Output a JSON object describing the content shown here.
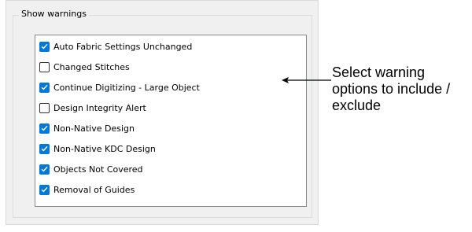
{
  "group": {
    "title": "Show warnings"
  },
  "warnings": [
    {
      "label": "Auto Fabric Settings Unchanged",
      "checked": true
    },
    {
      "label": "Changed Stitches",
      "checked": false
    },
    {
      "label": "Continue Digitizing - Large Object",
      "checked": true
    },
    {
      "label": "Design Integrity Alert",
      "checked": false
    },
    {
      "label": "Non-Native Design",
      "checked": true
    },
    {
      "label": "Non-Native KDC Design",
      "checked": true
    },
    {
      "label": "Objects Not Covered",
      "checked": true
    },
    {
      "label": "Removal of Guides",
      "checked": true
    }
  ],
  "callout": {
    "lines": [
      "Select warning",
      "options to include /",
      "exclude"
    ]
  },
  "colors": {
    "checkbox_checked": "#0078d7",
    "panel_bg": "#f0f0f0"
  }
}
